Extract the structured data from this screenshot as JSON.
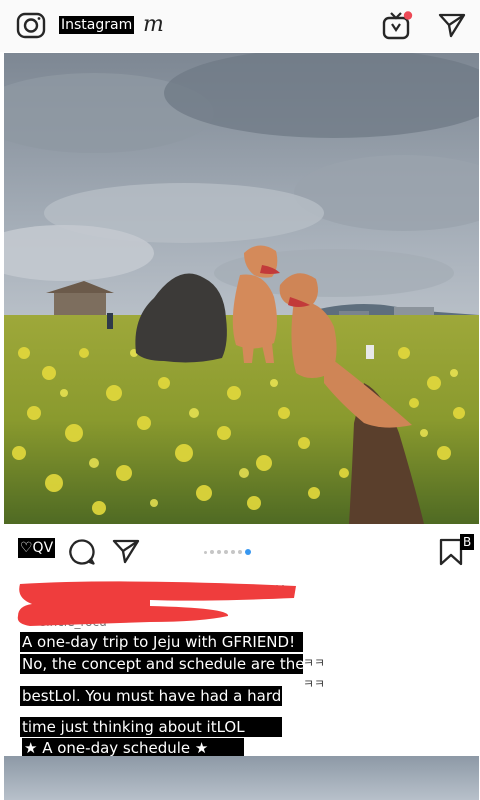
{
  "header": {
    "app_name": "Instagram",
    "wordmark_tail": "m",
    "icons": [
      "camera-icon",
      "igtv-icon",
      "direct-message-icon"
    ],
    "notification_color": "#ed4956"
  },
  "post": {
    "like_label": "♡QV",
    "carousel": {
      "total": 7,
      "active": 7
    },
    "bookmark_label": "B",
    "caption_lines": [
      "A one-day trip to Jeju with GFRIEND!",
      "No, the concept and schedule are the",
      "bestLol. You must have had a hard",
      "time just thinking about itLOL",
      "★ A one-day schedule ★"
    ],
    "caption_tail_glyph": "ㅋㅋ"
  },
  "colors": {
    "accent": "#3897f0",
    "redaction": "#ef3d3d",
    "caption_bg": "#000000"
  }
}
